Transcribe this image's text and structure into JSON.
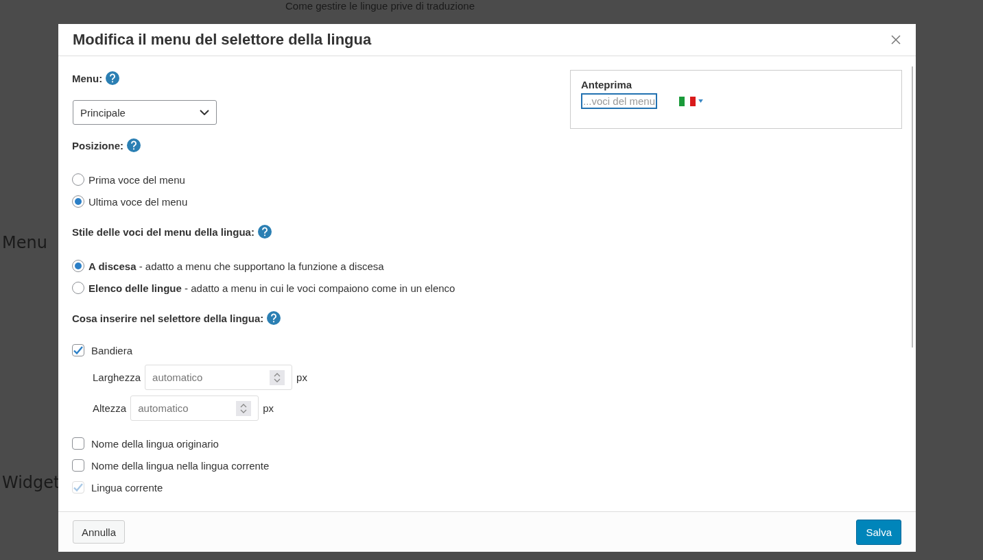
{
  "background": {
    "heading": "Come gestire le lingue prive di traduzione",
    "labels": [
      "Menu",
      "Widget"
    ]
  },
  "dialog": {
    "title": "Modifica il menu del selettore della lingua",
    "menu_field": {
      "label": "Menu:",
      "value": "Principale"
    },
    "position": {
      "label": "Posizione:",
      "options": [
        {
          "label": "Prima voce del menu",
          "selected": false
        },
        {
          "label": "Ultima voce del menu",
          "selected": true
        }
      ]
    },
    "style": {
      "label": "Stile delle voci del menu della lingua:",
      "options": [
        {
          "label": "**A discesa** - adatto a menu che supportano la funzione a discesa",
          "selected": true
        },
        {
          "label": "**Elenco delle lingue** - adatto a menu in cui le voci compaiono come in un elenco",
          "selected": false
        }
      ]
    },
    "content": {
      "label": "Cosa inserire nel selettore della lingua:",
      "items": [
        {
          "label": "Bandiera",
          "checked": true,
          "disabled": false,
          "fields": [
            {
              "label": "Larghezza",
              "placeholder": "automatico",
              "unit": "px"
            },
            {
              "label": "Altezza",
              "placeholder": "automatico",
              "unit": "px"
            }
          ]
        },
        {
          "label": "Nome della lingua originario",
          "checked": false,
          "disabled": false
        },
        {
          "label": "Nome della lingua nella lingua corrente",
          "checked": false,
          "disabled": false
        },
        {
          "label": "Lingua corrente",
          "checked": true,
          "disabled": true
        }
      ]
    },
    "preview": {
      "title": "Anteprima",
      "menu_item": "...voci del menu"
    },
    "buttons": {
      "cancel": "Annulla",
      "save": "Salva"
    }
  }
}
